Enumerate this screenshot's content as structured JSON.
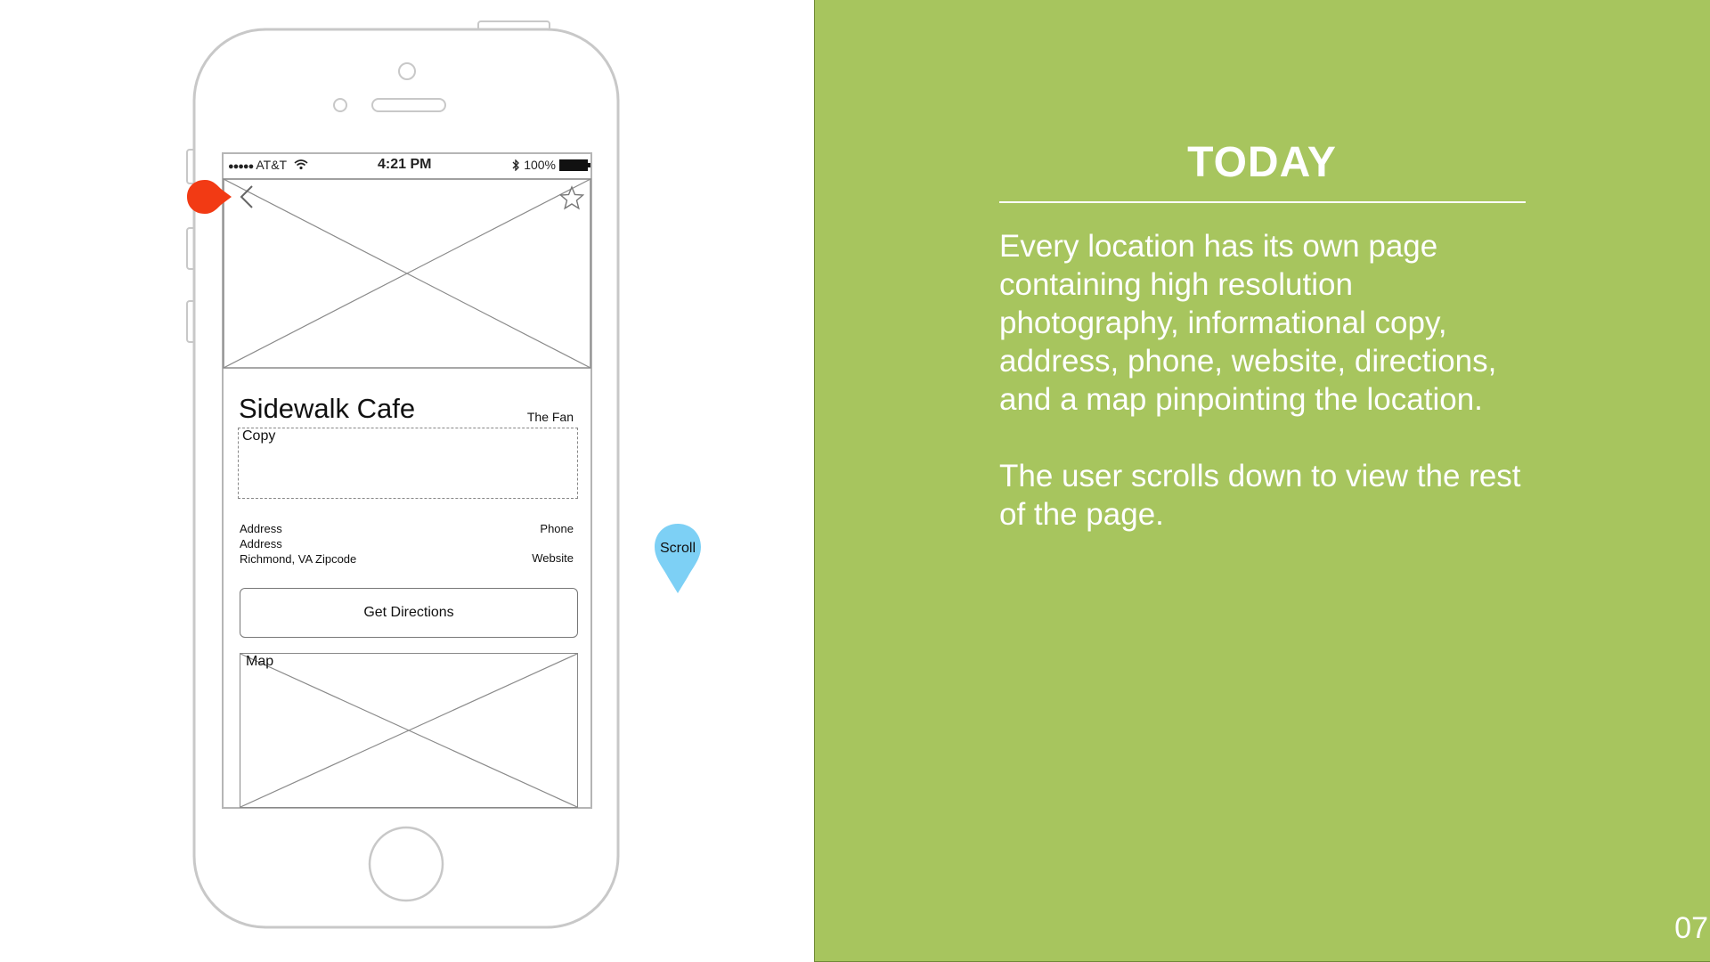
{
  "phone": {
    "status_bar": {
      "carrier": "AT&T",
      "time": "4:21 PM",
      "battery": "100%"
    },
    "screen": {
      "cafe_name": "Sidewalk Cafe",
      "neighborhood": "The Fan",
      "copy_label": "Copy",
      "address_lines": [
        "Address",
        "Address",
        "Richmond, VA Zipcode"
      ],
      "phone_label": "Phone",
      "website_label": "Website",
      "directions_button": "Get Directions",
      "map_label": "Map"
    },
    "icons": {
      "back": "chevron-left-icon",
      "favorite": "star-icon",
      "wifi": "wifi-icon",
      "bluetooth": "bluetooth-icon"
    }
  },
  "annotations": {
    "scroll_pin_label": "Scroll",
    "scroll_pin_color": "#7dd0f5",
    "marker_color": "#f23a14"
  },
  "panel": {
    "title": "TODAY",
    "paragraphs": [
      "Every location has its own page containing high resolution photography, informational copy, address, phone, website, directions, and a map pinpointing the location.",
      "The user scrolls down to view the rest of the page."
    ],
    "page_number": "07",
    "background_color": "#a7c55e"
  }
}
